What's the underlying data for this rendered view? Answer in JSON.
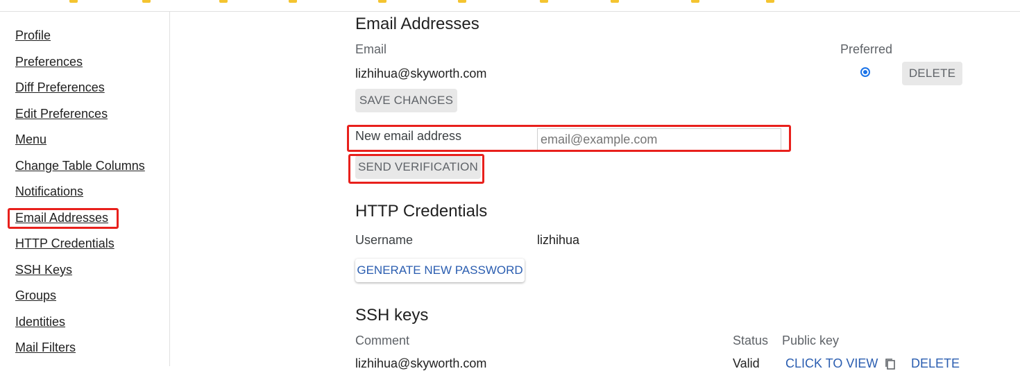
{
  "sidebar": {
    "items": [
      {
        "label": "Profile"
      },
      {
        "label": "Preferences"
      },
      {
        "label": "Diff Preferences"
      },
      {
        "label": "Edit Preferences"
      },
      {
        "label": "Menu"
      },
      {
        "label": "Change Table Columns"
      },
      {
        "label": "Notifications"
      },
      {
        "label": "Email Addresses"
      },
      {
        "label": "HTTP Credentials"
      },
      {
        "label": "SSH Keys"
      },
      {
        "label": "Groups"
      },
      {
        "label": "Identities"
      },
      {
        "label": "Mail Filters"
      }
    ]
  },
  "email_section": {
    "title": "Email Addresses",
    "col_email": "Email",
    "col_preferred": "Preferred",
    "rows": [
      {
        "email": "lizhihua@skyworth.com",
        "preferred": true,
        "delete_label": "DELETE"
      }
    ],
    "save_label": "SAVE CHANGES",
    "new_email_label": "New email address",
    "new_email_placeholder": "email@example.com",
    "new_email_value": "",
    "send_label": "SEND VERIFICATION"
  },
  "http_section": {
    "title": "HTTP Credentials",
    "username_label": "Username",
    "username_value": "lizhihua",
    "generate_label": "GENERATE NEW PASSWORD"
  },
  "ssh_section": {
    "title": "SSH keys",
    "col_comment": "Comment",
    "col_status": "Status",
    "col_public_key": "Public key",
    "rows": [
      {
        "comment": "lizhihua@skyworth.com",
        "status": "Valid",
        "view_label": "CLICK TO VIEW",
        "delete_label": "DELETE"
      }
    ]
  },
  "colors": {
    "accent": "#2a5db0",
    "highlight": "#e8201c",
    "radio": "#1a73e8"
  },
  "icons": [
    "copy-icon"
  ]
}
